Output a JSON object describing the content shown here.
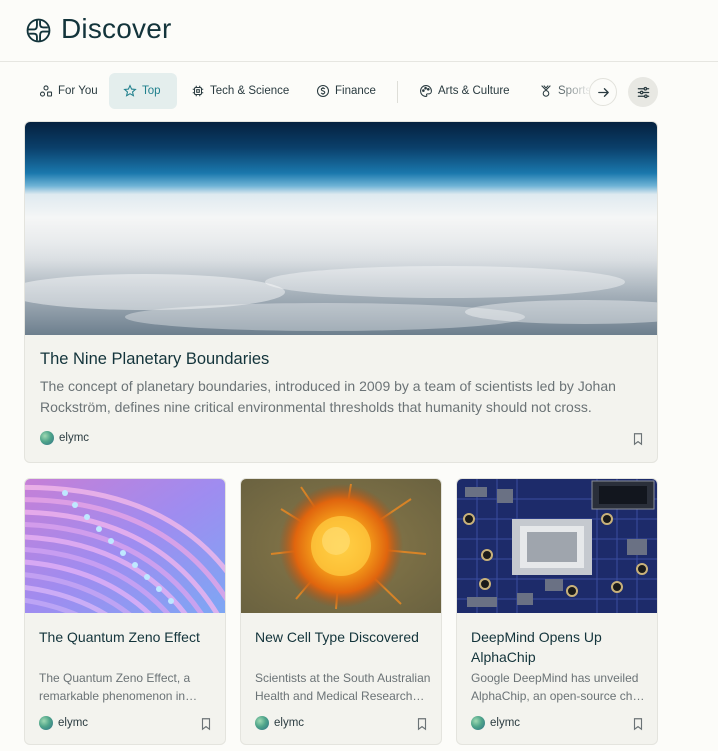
{
  "header": {
    "title": "Discover"
  },
  "tabs": [
    {
      "label": "For You",
      "icon": "people-icon"
    },
    {
      "label": "Top",
      "icon": "star-icon",
      "active": true
    },
    {
      "label": "Tech & Science",
      "icon": "chip-icon"
    },
    {
      "label": "Finance",
      "icon": "dollar-icon"
    },
    {
      "label": "Arts & Culture",
      "icon": "palette-icon"
    },
    {
      "label": "Sports",
      "icon": "trophy-icon"
    }
  ],
  "hero": {
    "title": "The Nine Planetary Boundaries",
    "description": "The concept of planetary boundaries, introduced in 2009 by a team of scientists led by Johan Rockström, defines nine critical environmental thresholds that humanity should not cross.",
    "author": "elymc"
  },
  "cards": [
    {
      "title": "The Quantum Zeno Effect",
      "description": "The Quantum Zeno Effect, a remarkable phenomenon in quantum mechanics.",
      "author": "elymc"
    },
    {
      "title": "New Cell Type Discovered",
      "description": "Scientists at the South Australian Health and Medical Research Institute.",
      "author": "elymc"
    },
    {
      "title": "DeepMind Opens Up AlphaChip",
      "description": "Google DeepMind has unveiled AlphaChip, an open-source chip design method.",
      "author": "elymc"
    }
  ],
  "colors": {
    "accent": "#20808d",
    "text": "#13343b",
    "muted": "#6b7376",
    "background": "#fcfcf9"
  }
}
